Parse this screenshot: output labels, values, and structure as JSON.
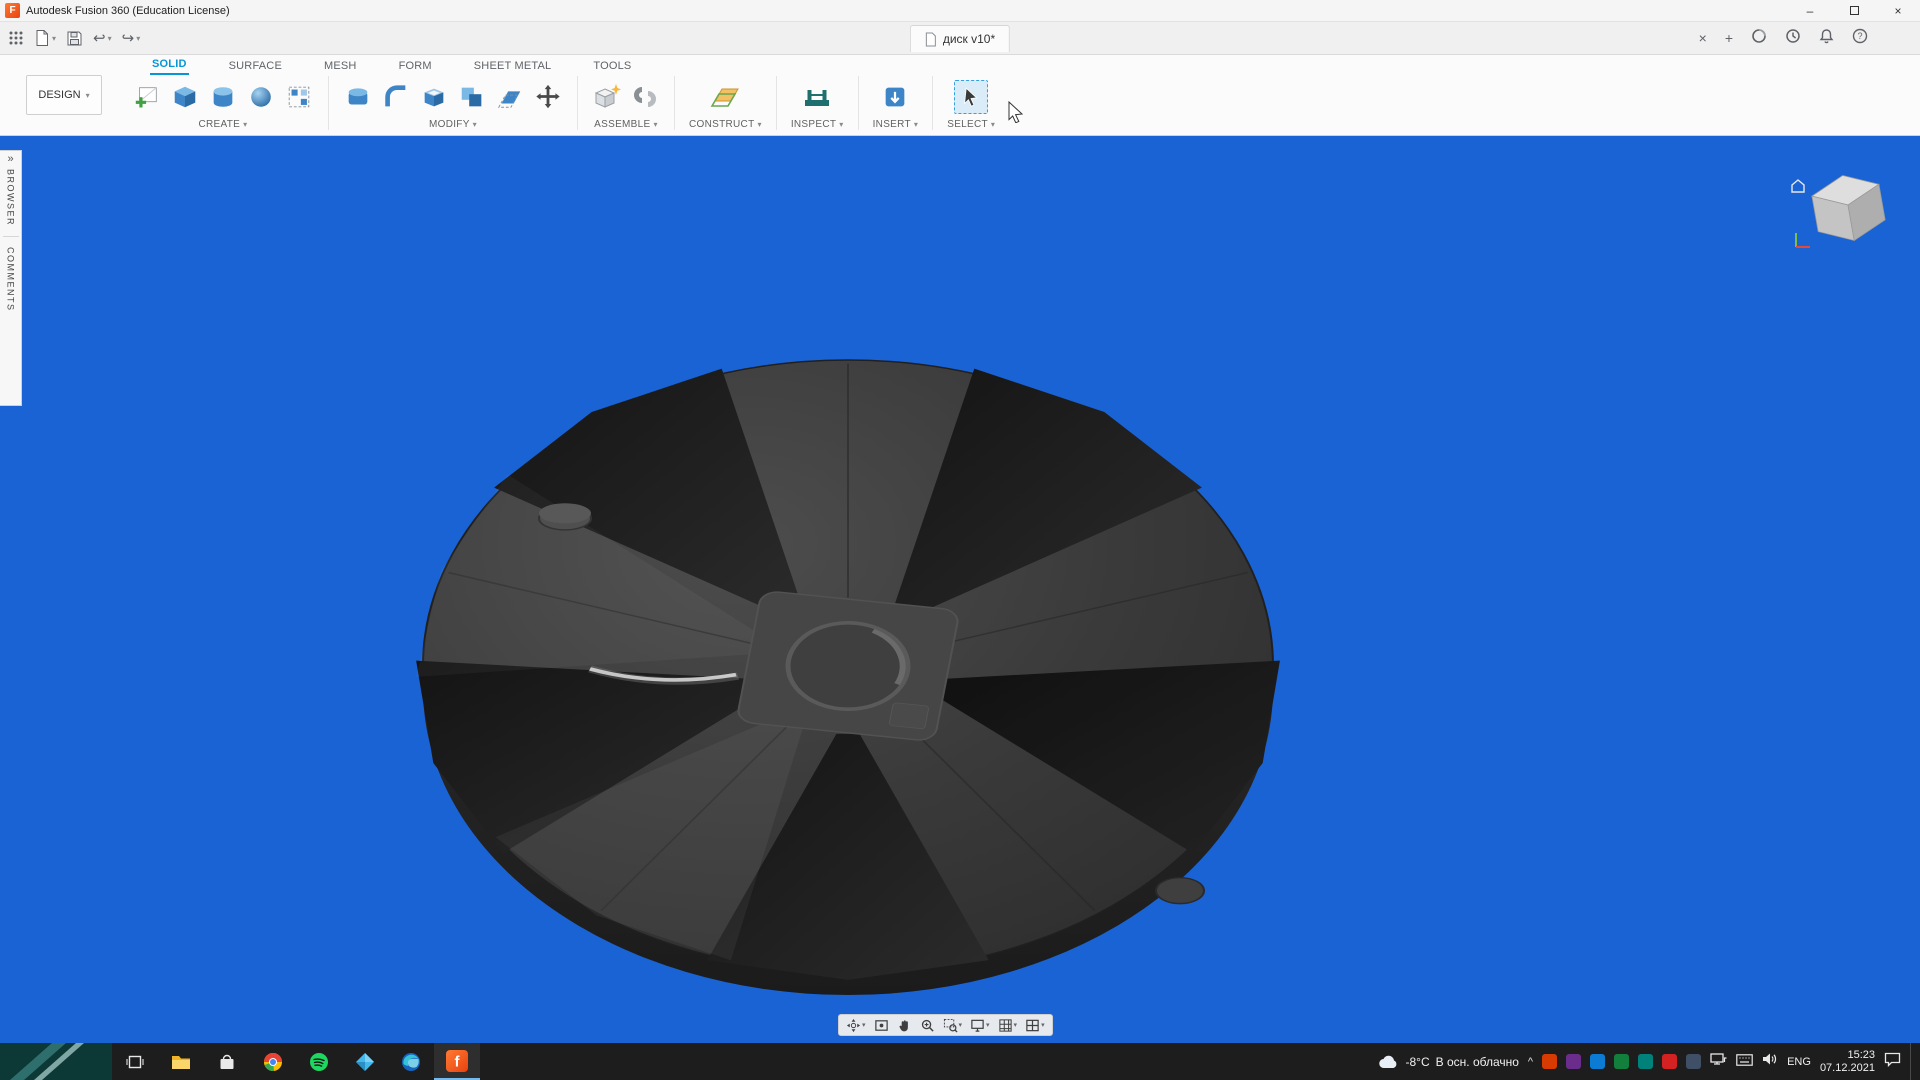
{
  "window": {
    "app_title": "Autodesk Fusion 360 (Education License)"
  },
  "icons": {
    "caret_down": "▾",
    "chevron_expand": "»",
    "close": "×",
    "plus": "+",
    "minimize": "–",
    "undo": "↩",
    "redo": "↪",
    "help_glyph": "?",
    "tray_expand": "^"
  },
  "quickbar": {
    "document_tab": "диск v10*"
  },
  "ribbon": {
    "design_button": "DESIGN",
    "active_tab": "SOLID",
    "tabs": [
      "SOLID",
      "SURFACE",
      "MESH",
      "FORM",
      "SHEET METAL",
      "TOOLS"
    ],
    "groups": [
      "CREATE",
      "MODIFY",
      "ASSEMBLE",
      "CONSTRUCT",
      "INSPECT",
      "INSERT",
      "SELECT"
    ]
  },
  "side_panels": {
    "browser": "BROWSER",
    "comments": "COMMENTS"
  },
  "taskbar": {
    "weather_temp": "-8°C",
    "weather_desc": "В осн. облачно",
    "language": "ENG",
    "time": "15:23",
    "date": "07.12.2021",
    "tray_colors": [
      "#d83b01",
      "#6b2d8b",
      "#0b7bd4",
      "#12803c",
      "#00827a",
      "#d42222",
      "#3f4f66"
    ]
  },
  "colors": {
    "viewport_bg": "#1a63d4",
    "accent_blue": "#0696d7",
    "ribbon_bg": "#fbfbfb",
    "taskbar_bg": "#1d1d1d",
    "fusion_orange": "#f26722",
    "model_gray": "#3a3a3a"
  }
}
